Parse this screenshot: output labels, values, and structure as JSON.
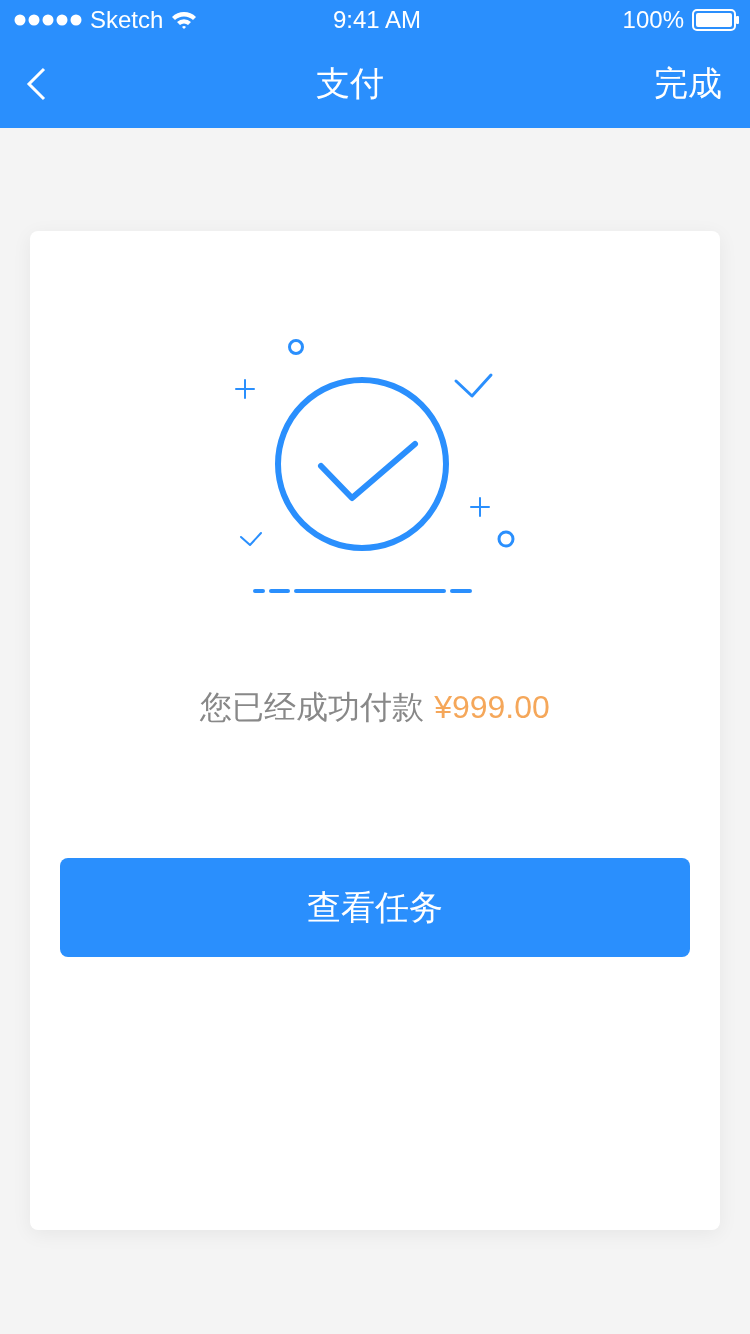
{
  "status_bar": {
    "carrier": "Sketch",
    "time": "9:41 AM",
    "battery": "100%"
  },
  "nav_bar": {
    "title": "支付",
    "action": "完成"
  },
  "result": {
    "message": "您已经成功付款",
    "amount": "¥999.00"
  },
  "button": {
    "label": "查看任务"
  }
}
